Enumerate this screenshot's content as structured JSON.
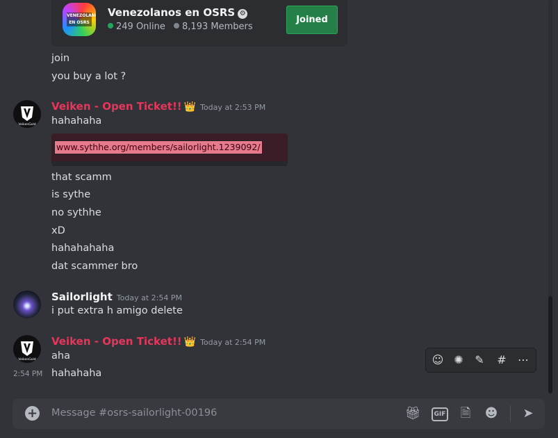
{
  "invite": {
    "icon_text": "VENEZOLANOS EN OSRS",
    "name": "Venezolanos en OSRS",
    "online_count": "249 Online",
    "member_count": "8,193 Members",
    "joined_label": "Joined"
  },
  "earlier_messages": [
    "join",
    "you buy a lot ?"
  ],
  "groups": [
    {
      "author": "Veiken - Open Ticket!!",
      "timestamp": "Today at 2:53 PM",
      "lines": [
        "hahahaha"
      ],
      "embed_link": "www.sythhe.org/members/sailorlight.1239092/",
      "after_embed": [
        "that scamm",
        "is sythe",
        "no sythhe",
        "xD",
        "hahahahaha",
        "dat scammer bro"
      ]
    },
    {
      "author": "Sailorlight",
      "timestamp": "Today at 2:54 PM",
      "lines": [
        "i put extra h amigo delete"
      ]
    },
    {
      "author": "Veiken - Open Ticket!!",
      "timestamp": "Today at 2:54 PM",
      "lines": [
        "aha",
        "hahahaha"
      ],
      "hover_timestamp": "2:54 PM"
    }
  ],
  "avatar_text": "VeikenGold",
  "crown_glyph": "👑",
  "composer": {
    "placeholder": "Message #osrs-sailorlight-00196",
    "gif_label": "GIF"
  },
  "colors": {
    "accent_red": "#e6365b",
    "join_green": "#248046",
    "background": "#313338"
  },
  "icons": {
    "toolbar": [
      "add-reaction-icon",
      "super-reaction-icon",
      "edit-icon",
      "create-thread-icon",
      "more-icon"
    ],
    "composer": [
      "plus-icon",
      "gift-icon",
      "gif-icon",
      "sticker-icon",
      "emoji-icon",
      "send-icon"
    ]
  }
}
